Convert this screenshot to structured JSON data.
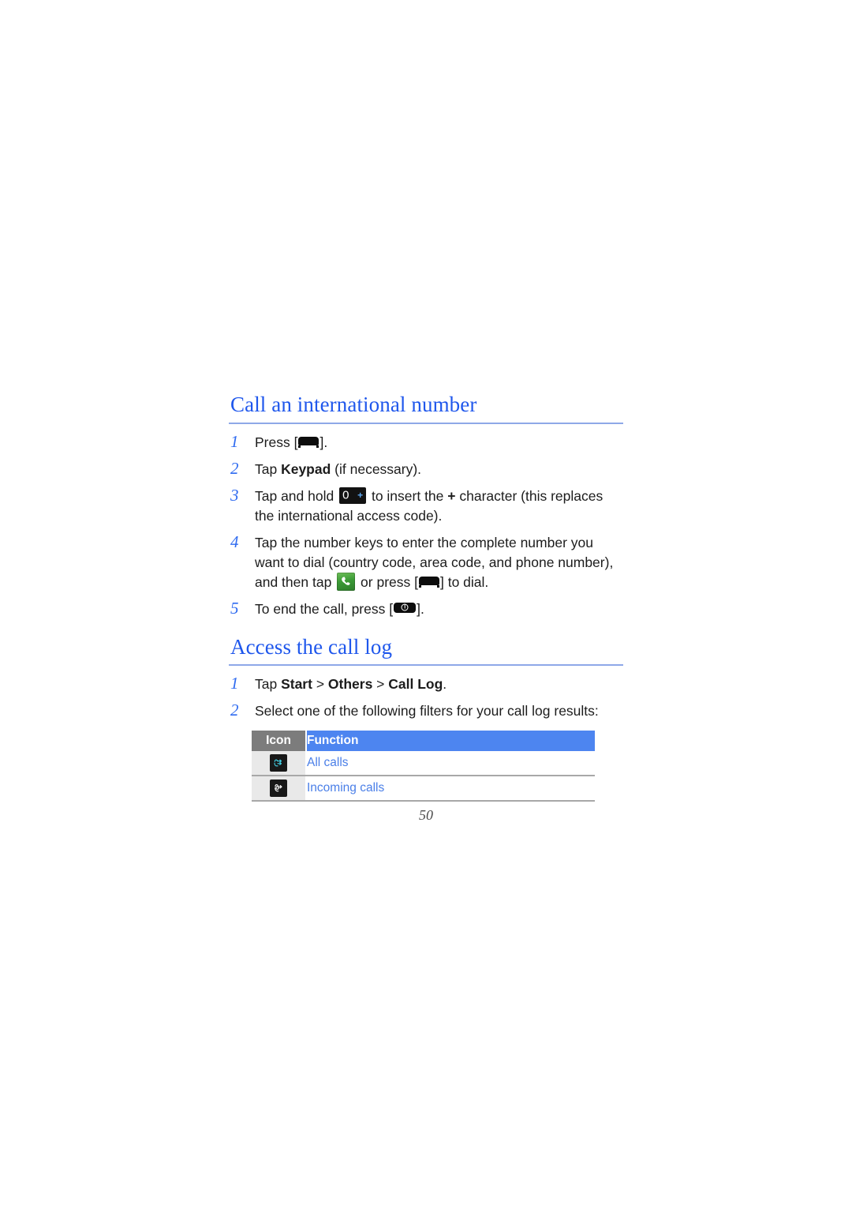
{
  "document": {
    "page_number": "50"
  },
  "sections": [
    {
      "heading": "Call an international number",
      "steps": [
        {
          "number": "1",
          "text_before": "Press [",
          "text_after": "]."
        },
        {
          "number": "2",
          "text": "Tap Keypad (if necessary)."
        },
        {
          "number": "3",
          "text_before": "Tap and hold ",
          "text_after": " to insert the + character (this replaces the international access code)."
        },
        {
          "number": "4",
          "text_before": "Tap the number keys to enter the complete number you want to dial (country code, area code, and phone number), and then tap ",
          "text_mid": " or press [",
          "text_after": "] to dial."
        },
        {
          "number": "5",
          "text_before": "To end the call, press [",
          "text_after": "]."
        }
      ],
      "step2": {
        "lead": "Tap ",
        "bold": "Keypad",
        "tail": " (if necessary)."
      },
      "step3": {
        "lead": "Tap and hold ",
        "mid": " to insert the ",
        "plus": "+",
        "tail": " character (this replaces the international access code)."
      },
      "step4": {
        "lead": "Tap the number keys to enter the complete number you want to dial (country code, area code, and phone number), and then tap ",
        "mid": " or press [",
        "tail": "] to dial."
      },
      "step5": {
        "lead": "To end the call, press [",
        "tail": "]."
      },
      "step1": {
        "lead": "Press [",
        "tail": "]."
      }
    },
    {
      "heading": "Access the call log",
      "step1": {
        "lead": "Tap ",
        "b1": "Start",
        "sep1": " > ",
        "b2": "Others",
        "sep2": " > ",
        "b3": "Call Log",
        "tail": "."
      },
      "step2": {
        "text": "Select one of the following filters for your call log results:"
      }
    }
  ],
  "keys": {
    "send_key": "send-key",
    "end_key": "end-key",
    "zero_key_digit": "0",
    "zero_key_plus": "+",
    "dial_icon": "dial-icon"
  },
  "table": {
    "headers": {
      "icon": "Icon",
      "function": "Function"
    },
    "rows": [
      {
        "icon_name": "all-calls-icon",
        "function": "All calls"
      },
      {
        "icon_name": "incoming-calls-icon",
        "function": "Incoming calls"
      }
    ]
  },
  "colors": {
    "heading_blue": "#1f57ec",
    "step_number_blue": "#2f6bf0",
    "table_header_blue": "#4d85f0",
    "table_header_gray": "#7c7c7c",
    "table_text_blue": "#4a7fe8",
    "rule_blue": "#8ea8e8"
  }
}
